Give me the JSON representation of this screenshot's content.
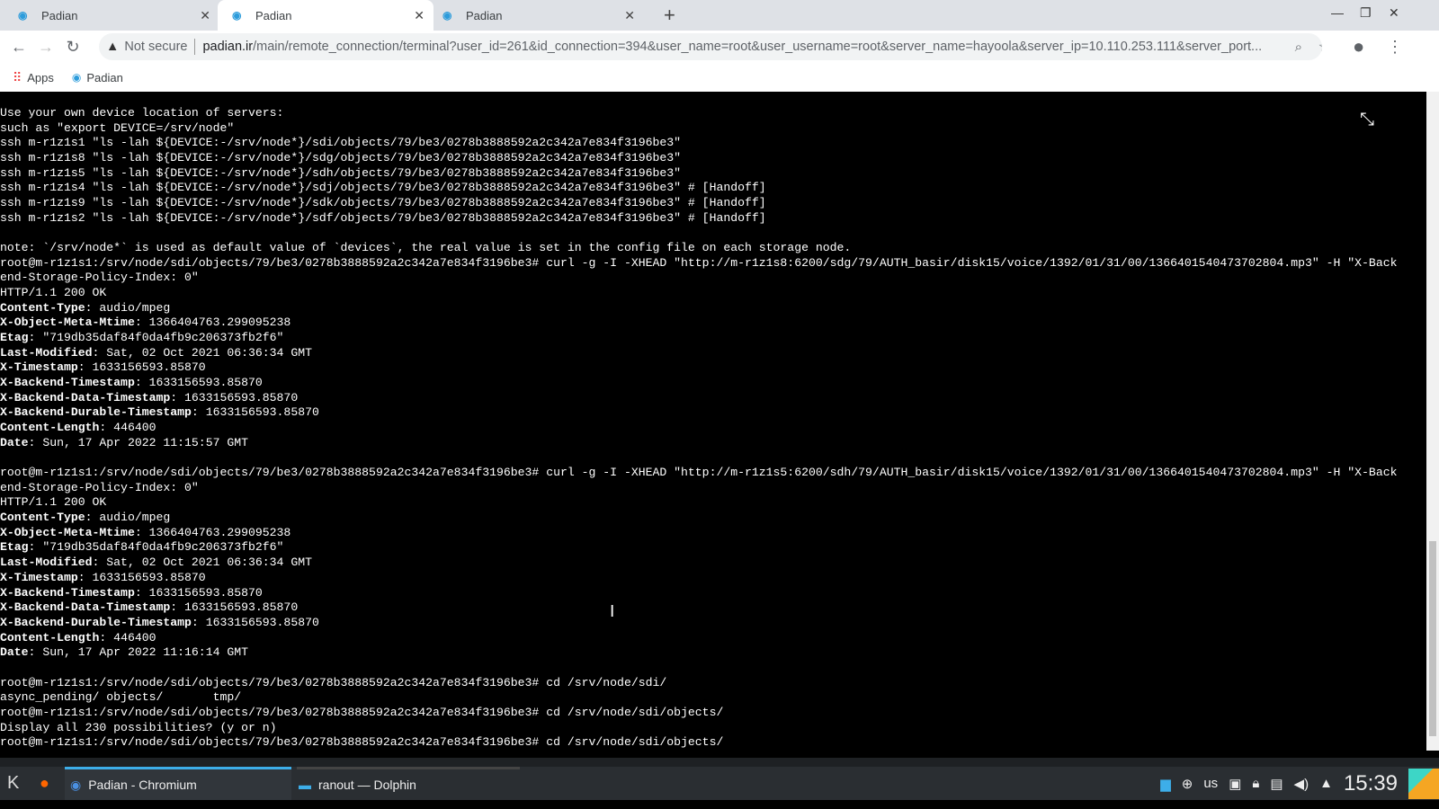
{
  "browser": {
    "tabs": [
      {
        "label": "Padian"
      },
      {
        "label": "Padian"
      },
      {
        "label": "Padian"
      }
    ],
    "security": "Not secure",
    "url_host": "padian.ir",
    "url_path": "/main/remote_connection/terminal?user_id=261&id_connection=394&user_name=root&user_username=root&server_name=hayoola&server_ip=10.110.253.111&server_port...",
    "bookmarks": [
      "Apps",
      "Padian"
    ]
  },
  "terminal": {
    "lines": [
      [
        [
          "",
          "Use your own device location of servers:"
        ]
      ],
      [
        [
          "",
          "such as \"export DEVICE=/srv/node\""
        ]
      ],
      [
        [
          "",
          "ssh m-r1z1s1 \"ls -lah ${DEVICE:-/srv/node*}/sdi/objects/79/be3/0278b3888592a2c342a7e834f3196be3\""
        ]
      ],
      [
        [
          "",
          "ssh m-r1z1s8 \"ls -lah ${DEVICE:-/srv/node*}/sdg/objects/79/be3/0278b3888592a2c342a7e834f3196be3\""
        ]
      ],
      [
        [
          "",
          "ssh m-r1z1s5 \"ls -lah ${DEVICE:-/srv/node*}/sdh/objects/79/be3/0278b3888592a2c342a7e834f3196be3\""
        ]
      ],
      [
        [
          "",
          "ssh m-r1z1s4 \"ls -lah ${DEVICE:-/srv/node*}/sdj/objects/79/be3/0278b3888592a2c342a7e834f3196be3\" # [Handoff]"
        ]
      ],
      [
        [
          "",
          "ssh m-r1z1s9 \"ls -lah ${DEVICE:-/srv/node*}/sdk/objects/79/be3/0278b3888592a2c342a7e834f3196be3\" # [Handoff]"
        ]
      ],
      [
        [
          "",
          "ssh m-r1z1s2 \"ls -lah ${DEVICE:-/srv/node*}/sdf/objects/79/be3/0278b3888592a2c342a7e834f3196be3\" # [Handoff]"
        ]
      ],
      [],
      [
        [
          "",
          "note: `/srv/node*` is used as default value of `devices`, the real value is set in the config file on each storage node."
        ]
      ],
      [
        [
          "",
          "root@m-r1z1s1:/srv/node/sdi/objects/79/be3/0278b3888592a2c342a7e834f3196be3# curl -g -I -XHEAD \"http://m-r1z1s8:6200/sdg/79/AUTH_basir/disk15/voice/1392/01/31/00/1366401540473702804.mp3\" -H \"X-Back"
        ]
      ],
      [
        [
          "",
          "end-Storage-Policy-Index: 0\""
        ]
      ],
      [
        [
          "",
          "HTTP/1.1 200 OK"
        ]
      ],
      [
        [
          "b",
          "Content-Type"
        ],
        [
          "",
          ": audio/mpeg"
        ]
      ],
      [
        [
          "b",
          "X-Object-Meta-Mtime"
        ],
        [
          "",
          ": 1366404763.299095238"
        ]
      ],
      [
        [
          "b",
          "Etag"
        ],
        [
          "",
          ": \"719db35daf84f0da4fb9c206373fb2f6\""
        ]
      ],
      [
        [
          "b",
          "Last-Modified"
        ],
        [
          "",
          ": Sat, 02 Oct 2021 06:36:34 GMT"
        ]
      ],
      [
        [
          "b",
          "X-Timestamp"
        ],
        [
          "",
          ": 1633156593.85870"
        ]
      ],
      [
        [
          "b",
          "X-Backend-Timestamp"
        ],
        [
          "",
          ": 1633156593.85870"
        ]
      ],
      [
        [
          "b",
          "X-Backend-Data-Timestamp"
        ],
        [
          "",
          ": 1633156593.85870"
        ]
      ],
      [
        [
          "b",
          "X-Backend-Durable-Timestamp"
        ],
        [
          "",
          ": 1633156593.85870"
        ]
      ],
      [
        [
          "b",
          "Content-Length"
        ],
        [
          "",
          ": 446400"
        ]
      ],
      [
        [
          "b",
          "Date"
        ],
        [
          "",
          ": Sun, 17 Apr 2022 11:15:57 GMT"
        ]
      ],
      [],
      [
        [
          "",
          "root@m-r1z1s1:/srv/node/sdi/objects/79/be3/0278b3888592a2c342a7e834f3196be3# curl -g -I -XHEAD \"http://m-r1z1s5:6200/sdh/79/AUTH_basir/disk15/voice/1392/01/31/00/1366401540473702804.mp3\" -H \"X-Back"
        ]
      ],
      [
        [
          "",
          "end-Storage-Policy-Index: 0\""
        ]
      ],
      [
        [
          "",
          "HTTP/1.1 200 OK"
        ]
      ],
      [
        [
          "b",
          "Content-Type"
        ],
        [
          "",
          ": audio/mpeg"
        ]
      ],
      [
        [
          "b",
          "X-Object-Meta-Mtime"
        ],
        [
          "",
          ": 1366404763.299095238"
        ]
      ],
      [
        [
          "b",
          "Etag"
        ],
        [
          "",
          ": \"719db35daf84f0da4fb9c206373fb2f6\""
        ]
      ],
      [
        [
          "b",
          "Last-Modified"
        ],
        [
          "",
          ": Sat, 02 Oct 2021 06:36:34 GMT"
        ]
      ],
      [
        [
          "b",
          "X-Timestamp"
        ],
        [
          "",
          ": 1633156593.85870"
        ]
      ],
      [
        [
          "b",
          "X-Backend-Timestamp"
        ],
        [
          "",
          ": 1633156593.85870"
        ]
      ],
      [
        [
          "b",
          "X-Backend-Data-Timestamp"
        ],
        [
          "",
          ": 1633156593.85870"
        ]
      ],
      [
        [
          "b",
          "X-Backend-Durable-Timestamp"
        ],
        [
          "",
          ": 1633156593.85870"
        ]
      ],
      [
        [
          "b",
          "Content-Length"
        ],
        [
          "",
          ": 446400"
        ]
      ],
      [
        [
          "b",
          "Date"
        ],
        [
          "",
          ": Sun, 17 Apr 2022 11:16:14 GMT"
        ]
      ],
      [],
      [
        [
          "",
          "root@m-r1z1s1:/srv/node/sdi/objects/79/be3/0278b3888592a2c342a7e834f3196be3# cd /srv/node/sdi/"
        ]
      ],
      [
        [
          "",
          "async_pending/ objects/       tmp/"
        ]
      ],
      [
        [
          "",
          "root@m-r1z1s1:/srv/node/sdi/objects/79/be3/0278b3888592a2c342a7e834f3196be3# cd /srv/node/sdi/objects/"
        ]
      ],
      [
        [
          "",
          "Display all 230 possibilities? (y or n)"
        ]
      ],
      [
        [
          "",
          "root@m-r1z1s1:/srv/node/sdi/objects/79/be3/0278b3888592a2c342a7e834f3196be3# cd /srv/node/sdi/objects/"
        ]
      ]
    ]
  },
  "taskbar": {
    "items": [
      {
        "label": "Padian - Chromium"
      },
      {
        "label": "ranout — Dolphin"
      }
    ],
    "keyboard": "us",
    "clock": "15:39"
  }
}
